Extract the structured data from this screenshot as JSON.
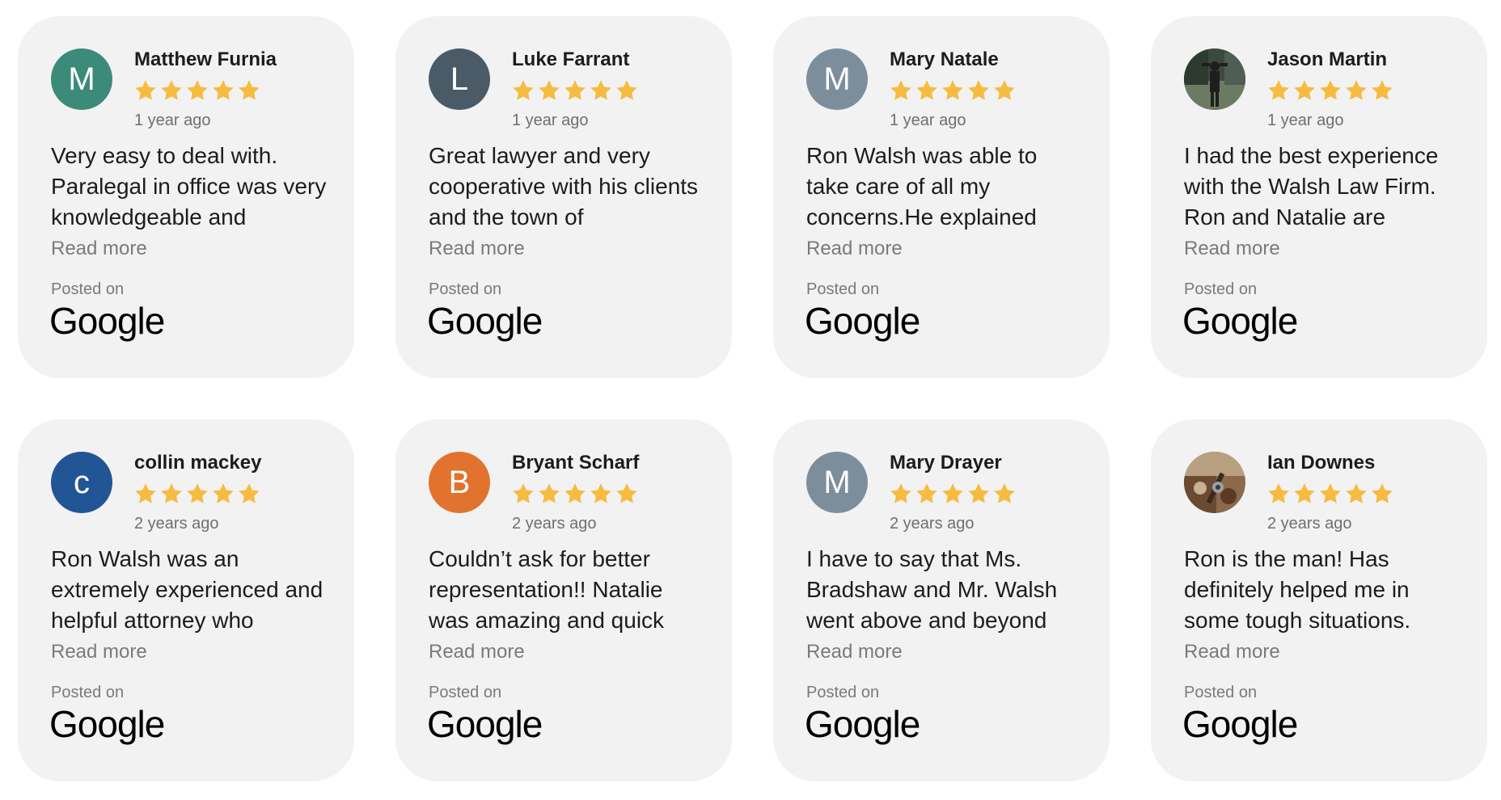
{
  "colors": {
    "card_bg": "#f2f2f2",
    "star": "#f6bb3f",
    "google_blue": "#4285f4",
    "muted_text": "#7a7a7a"
  },
  "reviews": [
    {
      "name": "Matthew Furnia",
      "initial": "M",
      "avatar_color": "#3c8a7a",
      "rating": 5,
      "time": "1 year ago",
      "text": "Very easy to deal with. Paralegal in office was very knowledgeable and",
      "read_more": "Read more",
      "posted_on": "Posted on",
      "platform": "Google"
    },
    {
      "name": "Luke Farrant",
      "initial": "L",
      "avatar_color": "#4a5a66",
      "rating": 5,
      "time": "1 year ago",
      "text": "Great lawyer and very cooperative with his clients and the town of",
      "read_more": "Read more",
      "posted_on": "Posted on",
      "platform": "Google"
    },
    {
      "name": "Mary Natale",
      "initial": "M",
      "avatar_color": "#7c8e9c",
      "rating": 5,
      "time": "1 year ago",
      "text": "Ron Walsh was able to take care of all my concerns.He explained",
      "read_more": "Read more",
      "posted_on": "Posted on",
      "platform": "Google"
    },
    {
      "name": "Jason Martin",
      "initial": "",
      "avatar_color": "#3b4a3e",
      "avatar_icon": "person-photo",
      "rating": 5,
      "time": "1 year ago",
      "text": "I had the best experience with the Walsh Law Firm. Ron and Natalie are",
      "read_more": "Read more",
      "posted_on": "Posted on",
      "platform": "Google"
    },
    {
      "name": "collin mackey",
      "initial": "c",
      "avatar_color": "#215595",
      "rating": 5,
      "time": "2 years ago",
      "text": "Ron Walsh was an extremely experienced and helpful attorney who",
      "read_more": "Read more",
      "posted_on": "Posted on",
      "platform": "Google"
    },
    {
      "name": "Bryant Scharf",
      "initial": "B",
      "avatar_color": "#e2732e",
      "rating": 5,
      "time": "2 years ago",
      "text": "Couldn’t ask for better representation!! Natalie was amazing and quick",
      "read_more": "Read more",
      "posted_on": "Posted on",
      "platform": "Google"
    },
    {
      "name": "Mary Drayer",
      "initial": "M",
      "avatar_color": "#7c8e9c",
      "rating": 5,
      "time": "2 years ago",
      "text": "I have to say that Ms. Bradshaw and Mr. Walsh went above and beyond",
      "read_more": "Read more",
      "posted_on": "Posted on",
      "platform": "Google"
    },
    {
      "name": "Ian Downes",
      "initial": "",
      "avatar_color": "#8a6a4a",
      "avatar_icon": "landscape-photo",
      "rating": 5,
      "time": "2 years ago",
      "text": "Ron is the man! Has definitely helped me in some tough situations.",
      "read_more": "Read more",
      "posted_on": "Posted on",
      "platform": "Google"
    }
  ]
}
